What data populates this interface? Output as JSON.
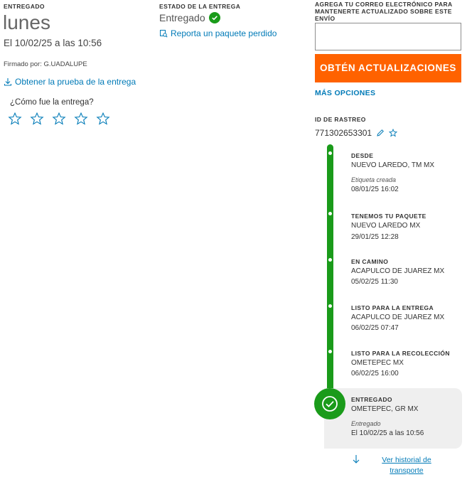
{
  "summary": {
    "delivered_label": "ENTREGADO",
    "day": "lunes",
    "date_line": "El 10/02/25 a las 10:56",
    "signed_by": "Firmado por: G.UADALUPE",
    "proof_link": "Obtener la prueba de la entrega",
    "rating_question": "¿Cómo fue la entrega?",
    "stars": 5
  },
  "status": {
    "label": "ESTADO DE LA ENTREGA",
    "value": "Entregado",
    "lost_link": "Reporta un paquete perdido"
  },
  "notifications": {
    "email_label": "AGREGA TU CORREO ELECTRÓNICO PARA MANTENERTE ACTUALIZADO SOBRE ESTE ENVÍO",
    "email_value": "",
    "button_label": "OBTÉN ACTUALIZACIONES",
    "more_options": "MÁS OPCIONES"
  },
  "tracking": {
    "label": "ID DE RASTREO",
    "number": "771302653301"
  },
  "timeline": {
    "events": [
      {
        "title": "DESDE",
        "location": "NUEVO LAREDO, TM MX",
        "note": "Etiqueta creada",
        "datetime": "08/01/25 16:02"
      },
      {
        "title": "TENEMOS TU PAQUETE",
        "location": "NUEVO LAREDO MX",
        "note": "",
        "datetime": "29/01/25 12:28"
      },
      {
        "title": "EN CAMINO",
        "location": "ACAPULCO DE JUAREZ MX",
        "note": "",
        "datetime": "05/02/25 11:30"
      },
      {
        "title": "LISTO PARA LA ENTREGA",
        "location": "ACAPULCO DE JUAREZ MX",
        "note": "",
        "datetime": "06/02/25 07:47"
      },
      {
        "title": "LISTO PARA LA RECOLECCIÓN",
        "location": "OMETEPEC MX",
        "note": "",
        "datetime": "06/02/25 16:00"
      },
      {
        "title": "ENTREGADO",
        "location": "OMETEPEC, GR MX",
        "note": "Entregado",
        "datetime": "El 10/02/25 a las 10:56"
      }
    ],
    "history_link": "Ver historial de transporte"
  },
  "colors": {
    "accent_orange": "#ff6200",
    "success_green": "#1a9b1a",
    "link_blue": "#007ab7"
  }
}
